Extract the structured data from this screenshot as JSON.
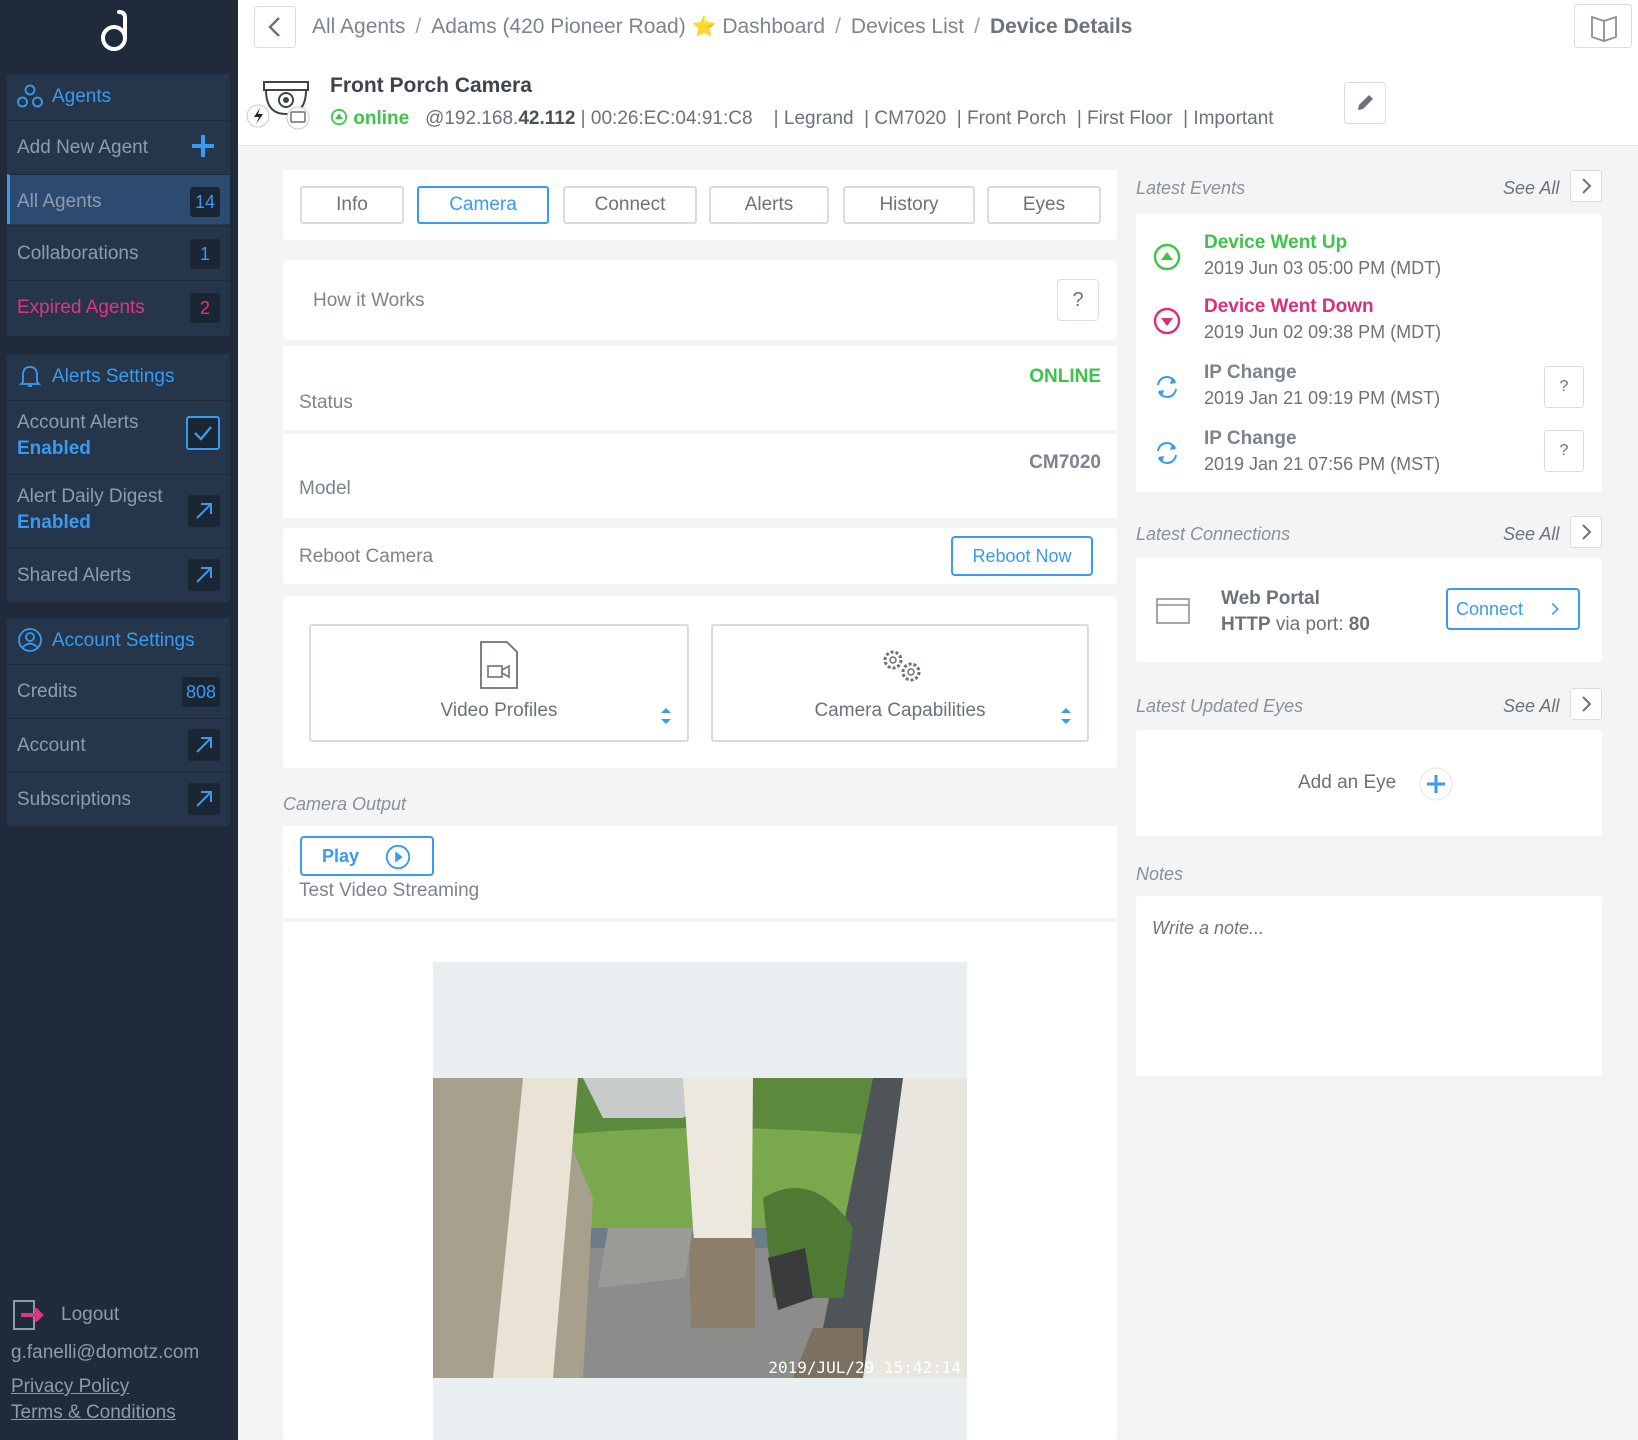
{
  "sidebar": {
    "agents_header": "Agents",
    "add_new_agent": "Add New Agent",
    "all_agents": {
      "label": "All Agents",
      "count": "14"
    },
    "collaborations": {
      "label": "Collaborations",
      "count": "1"
    },
    "expired_agents": {
      "label": "Expired Agents",
      "count": "2"
    },
    "alerts_header": "Alerts Settings",
    "account_alerts": {
      "label": "Account Alerts",
      "value": "Enabled"
    },
    "alert_daily_digest": {
      "label": "Alert Daily Digest",
      "value": "Enabled"
    },
    "shared_alerts": "Shared Alerts",
    "account_header": "Account Settings",
    "credits": {
      "label": "Credits",
      "count": "808"
    },
    "account": "Account",
    "subscriptions": "Subscriptions",
    "logout": "Logout",
    "email": "g.fanelli@domotz.com",
    "privacy": "Privacy Policy",
    "terms": "Terms & Conditions"
  },
  "breadcrumb": {
    "items": [
      "All Agents",
      "Adams (420 Pioneer Road)",
      "Dashboard",
      "Devices List"
    ],
    "current": "Device Details",
    "star": "⭐"
  },
  "device": {
    "name": "Front Porch Camera",
    "status": "online",
    "ip_prefix": "@192.168.",
    "ip_suffix": "42.112",
    "mac": "00:26:EC:04:91:C8",
    "tags": [
      "Legrand",
      "CM7020",
      "Front Porch",
      "First Floor",
      "Important"
    ]
  },
  "tabs": [
    "Info",
    "Camera",
    "Connect",
    "Alerts",
    "History",
    "Eyes"
  ],
  "active_tab": "Camera",
  "panel": {
    "how_it_works": "How it Works",
    "help_q": "?",
    "status_label": "Status",
    "status_value": "ONLINE",
    "model_label": "Model",
    "model_value": "CM7020",
    "reboot_label": "Reboot Camera",
    "reboot_button": "Reboot Now",
    "video_profiles": "Video Profiles",
    "camera_capabilities": "Camera Capabilities",
    "camera_output": "Camera Output",
    "play": "Play",
    "test_streaming": "Test Video Streaming",
    "timestamp": "2019/JUL/29 15:42:14"
  },
  "events": {
    "title": "Latest Events",
    "see_all": "See All",
    "items": [
      {
        "title": "Device Went Up",
        "date": "2019 Jun 03 05:00 PM (MDT)",
        "color": "#3fc34a"
      },
      {
        "title": "Device Went Down",
        "date": "2019 Jun 02 09:38 PM (MDT)",
        "color": "#d8307a"
      },
      {
        "title": "IP Change",
        "date": "2019 Jan 21 09:19 PM (MST)",
        "color": "#7c848d"
      },
      {
        "title": "IP Change",
        "date": "2019 Jan 21 07:56 PM (MST)",
        "color": "#7c848d"
      }
    ]
  },
  "connections": {
    "title": "Latest Connections",
    "see_all": "See All",
    "name": "Web Portal",
    "proto": "HTTP",
    "via": "via port:",
    "port": "80",
    "connect": "Connect"
  },
  "eyes": {
    "title": "Latest Updated Eyes",
    "see_all": "See All",
    "add": "Add an Eye"
  },
  "notes": {
    "title": "Notes",
    "placeholder": "Write a note..."
  },
  "colors": {
    "accent": "#3a9aef",
    "online": "#3fc34a",
    "alert": "#d8307a",
    "sidebar": "#1f2b3a"
  }
}
